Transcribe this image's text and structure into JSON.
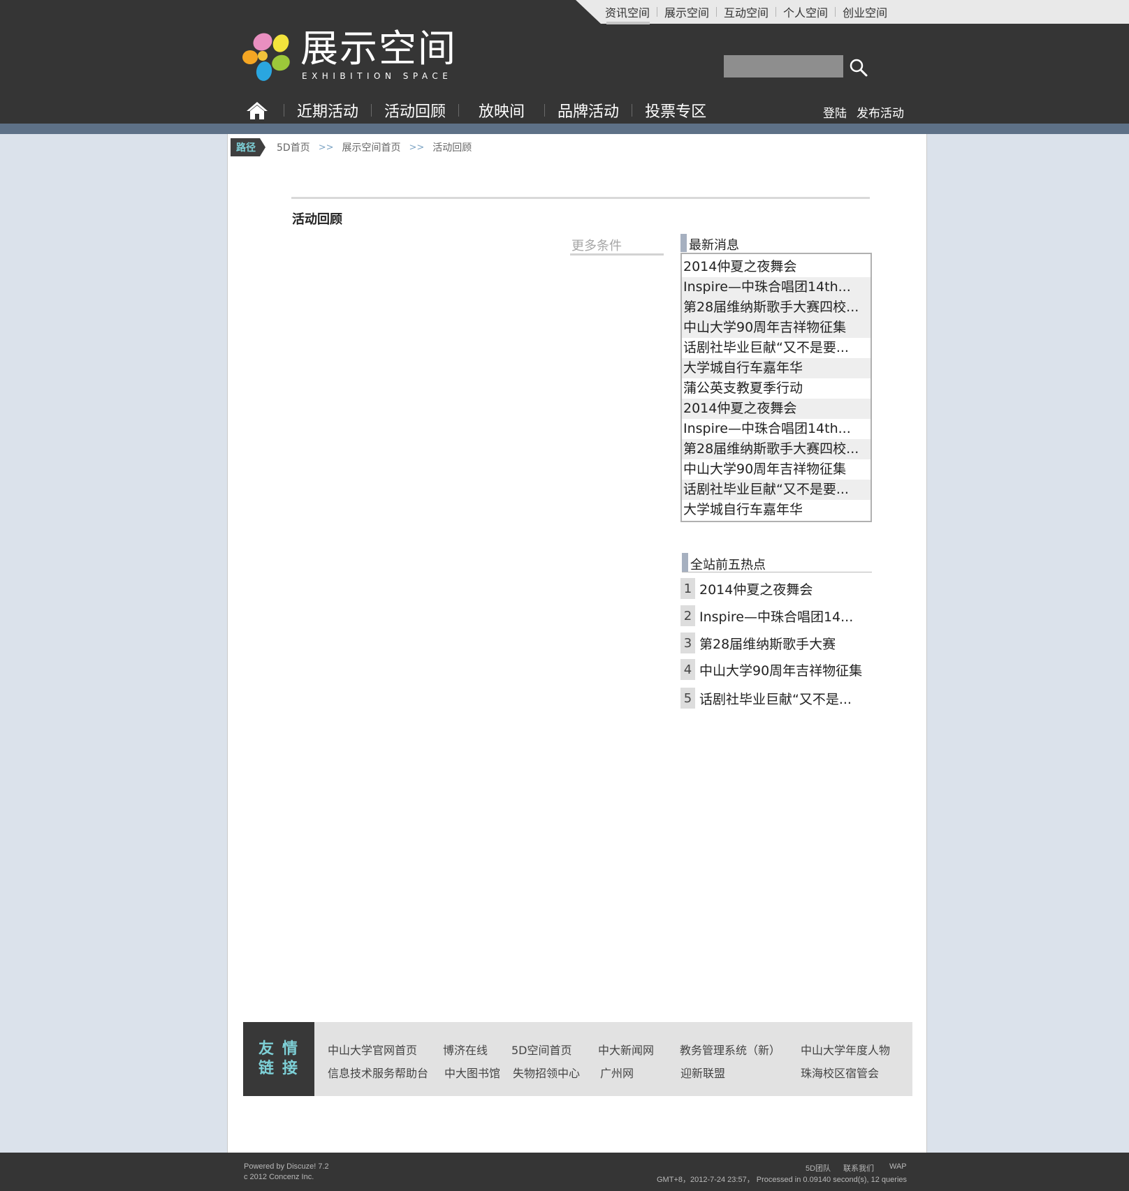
{
  "top_nav": [
    "资讯空间",
    "展示空间",
    "互动空间",
    "个人空间",
    "创业空间"
  ],
  "logo": {
    "title": "展示空间",
    "subtitle": "EXHIBITION SPACE"
  },
  "search": {
    "value": "",
    "placeholder": ""
  },
  "main_nav": [
    "近期活动",
    "活动回顾",
    "放映间",
    "品牌活动",
    "投票专区"
  ],
  "user_links": {
    "login": "登陆",
    "publish": "发布活动"
  },
  "breadcrumb": {
    "tag": "路径",
    "items": [
      "5D首页",
      "展示空间首页",
      "活动回顾"
    ],
    "separator": ">>"
  },
  "section": {
    "title": "活动回顾",
    "more_filter": "更多条件"
  },
  "latest_news": {
    "title": "最新消息",
    "items": [
      "2014仲夏之夜舞会",
      "Inspire—中珠合唱团14th...",
      "第28届维纳斯歌手大赛四校...",
      "中山大学90周年吉祥物征集",
      "话剧社毕业巨献“又不是要...",
      "大学城自行车嘉年华",
      "蒲公英支教夏季行动",
      "2014仲夏之夜舞会",
      "Inspire—中珠合唱团14th...",
      "第28届维纳斯歌手大赛四校...",
      "中山大学90周年吉祥物征集",
      "话剧社毕业巨献“又不是要...",
      "大学城自行车嘉年华"
    ]
  },
  "top_five": {
    "title": "全站前五热点",
    "items": [
      {
        "rank": "1",
        "title": "2014仲夏之夜舞会"
      },
      {
        "rank": "2",
        "title": "Inspire—中珠合唱团14..."
      },
      {
        "rank": "3",
        "title": "第28届维纳斯歌手大赛"
      },
      {
        "rank": "4",
        "title": "中山大学90周年吉祥物征集"
      },
      {
        "rank": "5",
        "title": "话剧社毕业巨献“又不是..."
      }
    ]
  },
  "friend_links": {
    "tag_line1": "友情",
    "tag_line2": "链接",
    "row1": [
      "中山大学官网首页",
      "博济在线",
      "5D空间首页",
      "中大新闻网",
      "教务管理系统（新）",
      "中山大学年度人物"
    ],
    "row2": [
      "信息技术服务帮助台",
      "中大图书馆",
      "失物招领中心",
      "广州网",
      "迎新联盟",
      "珠海校区宿管会"
    ]
  },
  "footer": {
    "powered": "Powered by Discuze! 7.2",
    "copyright": "c  2012 Concenz Inc.",
    "links": [
      "5D团队",
      "联系我们",
      "WAP"
    ],
    "status": "GMT+8，2012-7-24 23:57，  Processed in 0.09140 second(s), 12 queries"
  },
  "colors": {
    "header_bg": "#353535",
    "stripe": "#5e7187",
    "page_bg": "#dbe2eb",
    "accent_cyan": "#7ed0d7",
    "title_bar": "#a6b0c0"
  }
}
